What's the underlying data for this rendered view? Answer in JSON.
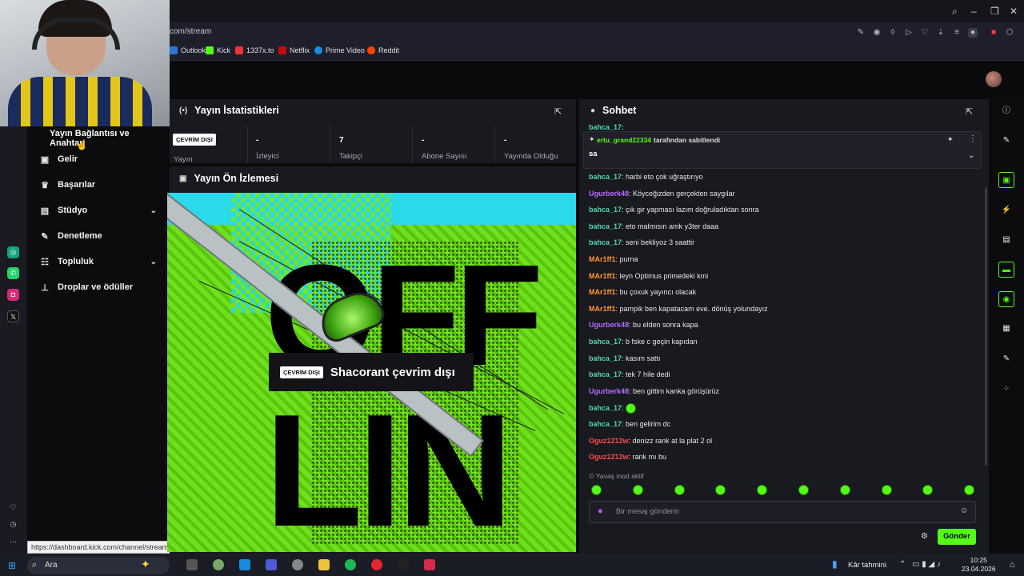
{
  "browser": {
    "url": "com/stream",
    "bookmarks": [
      "Outlook",
      "Kick",
      "1337x.to",
      "Netflix",
      "Prime Video",
      "Reddit"
    ]
  },
  "sidebar": {
    "tooltip": "Yayın Bağlantısı ve Anahtarı",
    "items": [
      {
        "label": "Gelir",
        "icon": "dollar-icon"
      },
      {
        "label": "Başarılar",
        "icon": "trophy-icon"
      },
      {
        "label": "Stüdyo",
        "icon": "studio-icon"
      },
      {
        "label": "Denetleme",
        "icon": "wrench-icon"
      },
      {
        "label": "Topluluk",
        "icon": "community-icon"
      },
      {
        "label": "Droplar ve ödüller",
        "icon": "drops-icon"
      }
    ],
    "status_url": "https://dashboard.kick.com/channel/stream"
  },
  "stats": {
    "title": "Yayın İstatistikleri",
    "badge": "ÇEVRİM DIŞI",
    "stream_label": "Yayın",
    "cells": [
      {
        "value": "-",
        "label": "İzleyici"
      },
      {
        "value": "7",
        "label": "Takipçi"
      },
      {
        "value": "-",
        "label": "Abone Sayısı"
      },
      {
        "value": "-",
        "label": "Yayında Olduğu"
      }
    ]
  },
  "preview": {
    "title": "Yayın Ön İzlemesi",
    "badge": "ÇEVRİM DIŞI",
    "offline_text": "Shacorant çevrim dışı",
    "big_text_1": "OFF",
    "big_text_2": "LIN"
  },
  "chat": {
    "title": "Sohbet",
    "top_partial": "bahca_17:",
    "pinned_by": "ertu_grand22334",
    "pinned_suffix": "tarafından sabitlendi",
    "pinned_message": "sa",
    "messages": [
      {
        "user": "bahca_17",
        "text": "harbi eto çok uğraştırıyo",
        "color": "#4fd6b0"
      },
      {
        "user": "Ugurberk48",
        "text": "Köyceğizden gerçekten saygılar",
        "color": "#b56bff"
      },
      {
        "user": "bahca_17",
        "text": "çık gir yapması lazım doğruladıktan sonra",
        "color": "#4fd6b0"
      },
      {
        "user": "bahca_17",
        "text": "eto malmısın amk y3ter daaa",
        "color": "#4fd6b0"
      },
      {
        "user": "bahca_17",
        "text": "seni bekliyoz 3 saattir",
        "color": "#4fd6b0"
      },
      {
        "user": "MAr1ff1",
        "text": "purna",
        "color": "#ff9a2e"
      },
      {
        "user": "MAr1ff1",
        "text": "leyn Optimus primedeki kmi",
        "color": "#ff9a2e"
      },
      {
        "user": "MAr1ff1",
        "text": "bu çoxuk yayıncı olacak",
        "color": "#ff9a2e"
      },
      {
        "user": "MAr1ff1",
        "text": "pampik ben kapatacam eve. dönüş yolundayız",
        "color": "#ff9a2e"
      },
      {
        "user": "Ugurberk48",
        "text": "bu elden sonra kapa",
        "color": "#b56bff"
      },
      {
        "user": "bahca_17",
        "text": "b fske c geçin kapıdan",
        "color": "#4fd6b0"
      },
      {
        "user": "bahca_17",
        "text": "kasım sattı",
        "color": "#4fd6b0"
      },
      {
        "user": "bahca_17",
        "text": "tek 7 hile dedi",
        "color": "#4fd6b0"
      },
      {
        "user": "Ugurberk48",
        "text": "ben gittim kanka görüşürüz",
        "color": "#b56bff"
      },
      {
        "user": "bahca_17",
        "text": "",
        "color": "#4fd6b0"
      },
      {
        "user": "bahca_17",
        "text": "ben gelirim dc",
        "color": "#4fd6b0"
      },
      {
        "user": "Oguz1212w",
        "text": "denizz rank at la plat 2 ol",
        "color": "#ff4a4a"
      },
      {
        "user": "Oguz1212w",
        "text": "rank mı bu",
        "color": "#ff4a4a"
      }
    ],
    "slow_mode": "Yavaş mod aktif",
    "input_placeholder": "Bir mesaj gönderin",
    "send_label": "Gönder"
  },
  "taskbar": {
    "search_label": "Ara",
    "weather": "Kâr tahmini",
    "time": "10:25",
    "date": "23.04.2026"
  },
  "colors": {
    "accent": "#53fc18",
    "panel": "#191920",
    "background": "#0b0b0d"
  }
}
